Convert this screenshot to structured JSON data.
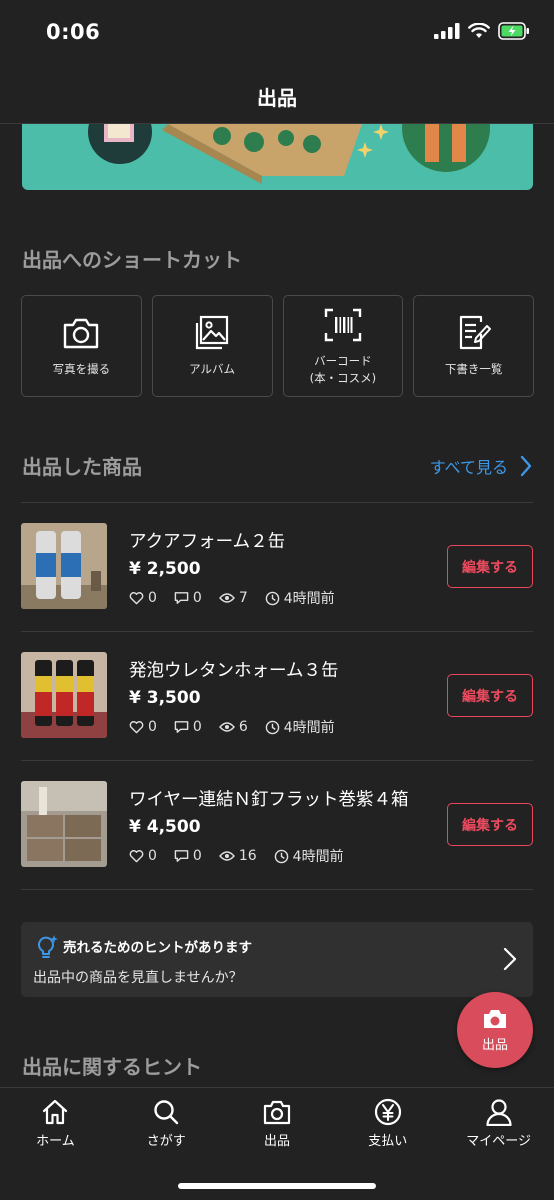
{
  "status_bar": {
    "time": "0:06"
  },
  "header": {
    "title": "出品"
  },
  "shortcuts": {
    "title": "出品へのショートカット",
    "items": [
      {
        "label": "写真を撮る",
        "icon": "camera-icon"
      },
      {
        "label": "アルバム",
        "icon": "album-icon"
      },
      {
        "label": "バーコード\n(本・コスメ)",
        "icon": "barcode-icon"
      },
      {
        "label": "下書き一覧",
        "icon": "draft-icon"
      }
    ]
  },
  "listed": {
    "title": "出品した商品",
    "see_all": "すべて見る",
    "items": [
      {
        "title": "アクアフォーム２缶",
        "price": "¥ 2,500",
        "likes": "0",
        "comments": "0",
        "views": "7",
        "time": "4時間前",
        "edit": "編集する"
      },
      {
        "title": "発泡ウレタンホォーム３缶",
        "price": "¥ 3,500",
        "likes": "0",
        "comments": "0",
        "views": "6",
        "time": "4時間前",
        "edit": "編集する"
      },
      {
        "title": "ワイヤー連結Ｎ釘フラット巻紫４箱",
        "price": "¥ 4,500",
        "likes": "0",
        "comments": "0",
        "views": "16",
        "time": "4時間前",
        "edit": "編集する"
      }
    ]
  },
  "hint": {
    "title": "売れるためのヒントがあります",
    "subtitle": "出品中の商品を見直しませんか？"
  },
  "tips": {
    "title": "出品に関するヒント"
  },
  "fab": {
    "label": "出品"
  },
  "tabs": [
    {
      "label": "ホーム",
      "icon": "home-icon"
    },
    {
      "label": "さがす",
      "icon": "search-icon"
    },
    {
      "label": "出品",
      "icon": "camera-icon"
    },
    {
      "label": "支払い",
      "icon": "yen-icon"
    },
    {
      "label": "マイページ",
      "icon": "person-icon"
    }
  ],
  "colors": {
    "accent": "#ec4b5f",
    "link": "#3d97e6",
    "banner": "#4bbda9",
    "background": "#222222"
  }
}
